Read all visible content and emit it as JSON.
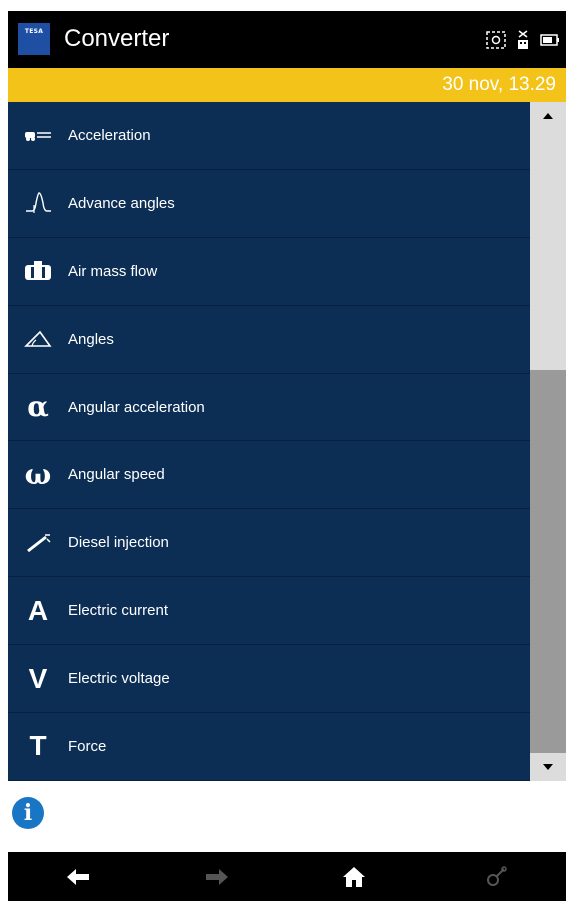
{
  "app": {
    "logo_text": "TESA",
    "title": "Converter",
    "status_icons": [
      "screenshot-icon",
      "usb-icon",
      "battery-icon"
    ]
  },
  "datebar": {
    "date": "30 nov, 13.29",
    "background": "#f3c31a"
  },
  "list": {
    "background": "#0c2e55",
    "items": [
      {
        "label": "Acceleration",
        "icon": "acceleration-icon"
      },
      {
        "label": "Advance angles",
        "icon": "advance-angles-icon"
      },
      {
        "label": "Air mass flow",
        "icon": "air-mass-flow-icon"
      },
      {
        "label": "Angles",
        "icon": "angles-icon"
      },
      {
        "label": "Angular acceleration",
        "icon": "alpha-icon",
        "glyph": "α"
      },
      {
        "label": "Angular speed",
        "icon": "omega-icon",
        "glyph": "ω"
      },
      {
        "label": "Diesel injection",
        "icon": "injector-icon"
      },
      {
        "label": "Electric current",
        "icon": "ampere-icon",
        "glyph": "A"
      },
      {
        "label": "Electric voltage",
        "icon": "volt-icon",
        "glyph": "V"
      },
      {
        "label": "Force",
        "icon": "force-icon",
        "glyph": "T"
      }
    ]
  },
  "scrollbar": {
    "position_fraction": 0.45
  },
  "bottom": {
    "info_glyph": "i",
    "nav": [
      "back-arrow-icon",
      "forward-arrow-icon",
      "home-icon",
      "settings-icon"
    ]
  }
}
